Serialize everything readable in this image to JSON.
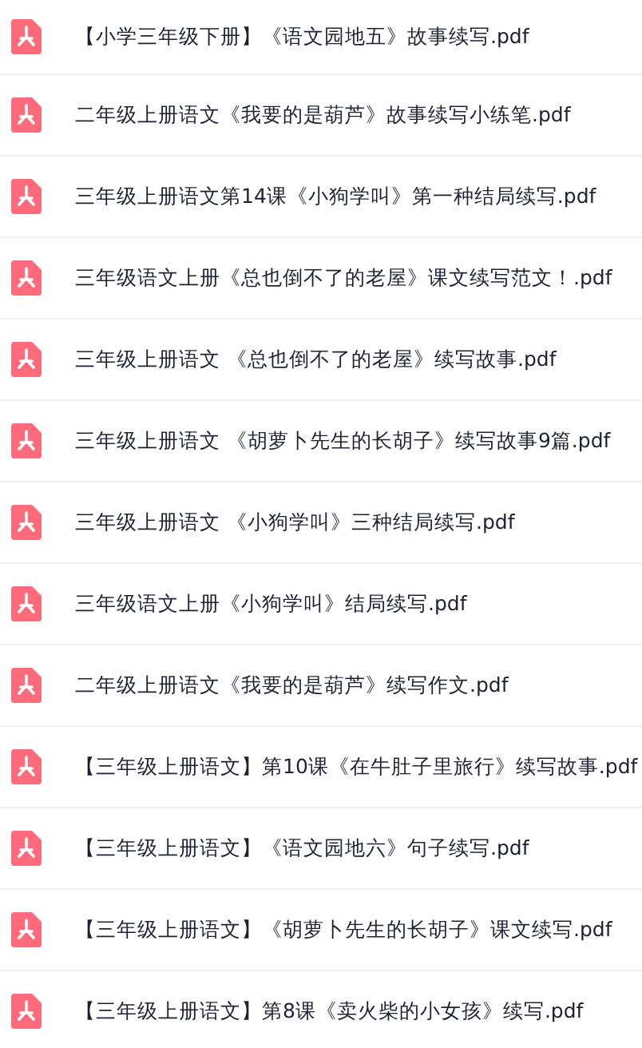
{
  "files": [
    {
      "name": "【小学三年级下册】《语文园地五》故事续写.pdf"
    },
    {
      "name": "二年级上册语文《我要的是葫芦》故事续写小练笔.pdf"
    },
    {
      "name": "三年级上册语文第14课《小狗学叫》第一种结局续写.pdf"
    },
    {
      "name": "三年级语文上册《总也倒不了的老屋》课文续写范文！.pdf"
    },
    {
      "name": "三年级上册语文 《总也倒不了的老屋》续写故事.pdf"
    },
    {
      "name": "三年级上册语文 《胡萝卜先生的长胡子》续写故事9篇.pdf"
    },
    {
      "name": "三年级上册语文 《小狗学叫》三种结局续写.pdf"
    },
    {
      "name": "三年级语文上册《小狗学叫》结局续写.pdf"
    },
    {
      "name": "二年级上册语文《我要的是葫芦》续写作文.pdf"
    },
    {
      "name": "【三年级上册语文】第10课《在牛肚子里旅行》续写故事.pdf"
    },
    {
      "name": "【三年级上册语文】《语文园地六》句子续写.pdf"
    },
    {
      "name": "【三年级上册语文】《胡萝卜先生的长胡子》课文续写.pdf"
    },
    {
      "name": "【三年级上册语文】第8课《卖火柴的小女孩》续写.pdf"
    }
  ]
}
